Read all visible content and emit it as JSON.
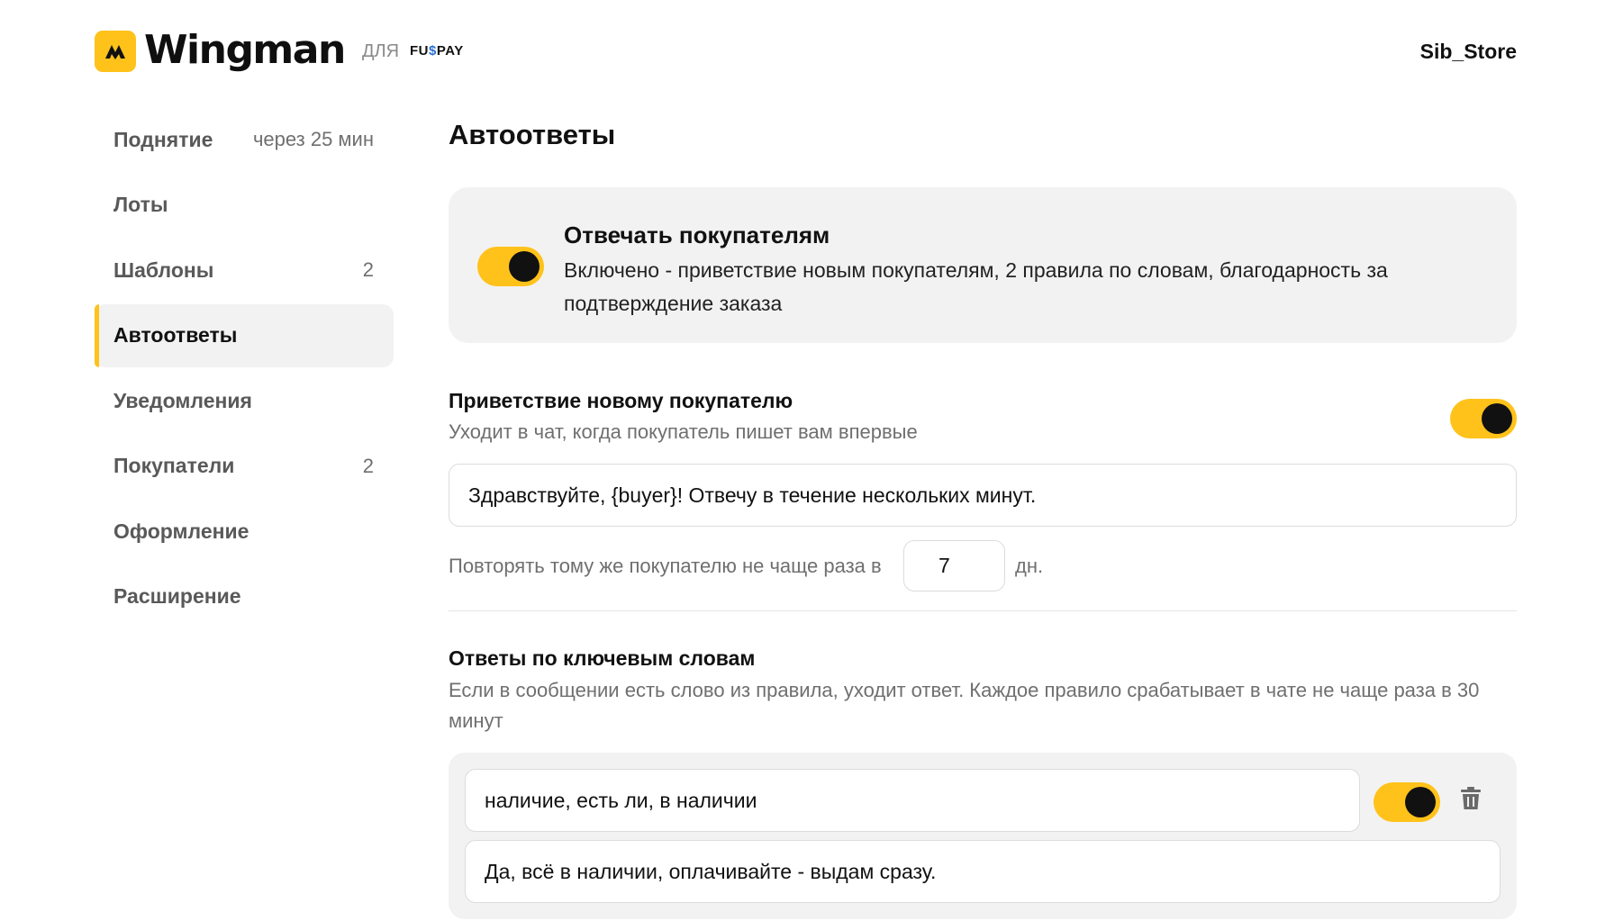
{
  "header": {
    "brand": "Wingman",
    "for_label": "ДЛЯ",
    "partner_prefix": "FU",
    "partner_dollar": "$",
    "partner_suffix": "PAY",
    "user": "Sib_Store"
  },
  "sidebar": {
    "items": [
      {
        "label": "Поднятие",
        "meta": "через 25 мин",
        "active": false
      },
      {
        "label": "Лоты",
        "meta": "",
        "active": false
      },
      {
        "label": "Шаблоны",
        "meta": "2",
        "active": false
      },
      {
        "label": "Автоответы",
        "meta": "",
        "active": true
      },
      {
        "label": "Уведомления",
        "meta": "",
        "active": false
      },
      {
        "label": "Покупатели",
        "meta": "2",
        "active": false
      },
      {
        "label": "Оформление",
        "meta": "",
        "active": false
      },
      {
        "label": "Расширение",
        "meta": "",
        "active": false
      }
    ]
  },
  "main": {
    "title": "Автоответы",
    "master": {
      "enabled": true,
      "title": "Отвечать покупателям",
      "description": "Включено - приветствие новым покупателям, 2 правила по словам, благодарность за подтверждение заказа"
    },
    "greeting": {
      "enabled": true,
      "title": "Приветствие новому покупателю",
      "description": "Уходит в чат, когда покупатель пишет вам впервые",
      "message": "Здравствуйте, {buyer}! Отвечу в течение нескольких минут.",
      "repeat_label": "Повторять тому же покупателю не чаще раза в",
      "repeat_value": "7",
      "repeat_unit": "дн."
    },
    "keywords": {
      "title": "Ответы по ключевым словам",
      "description": "Если в сообщении есть слово из правила, уходит ответ. Каждое правило срабатывает в чате не чаще раза в 30 минут",
      "rules": [
        {
          "enabled": true,
          "keywords": "наличие, есть ли, в наличии",
          "reply": "Да, всё в наличии, оплачивайте - выдам сразу."
        }
      ]
    }
  },
  "colors": {
    "accent": "#FFC21A",
    "card_bg": "#F2F2F2",
    "muted_text": "#6F6F6F"
  }
}
